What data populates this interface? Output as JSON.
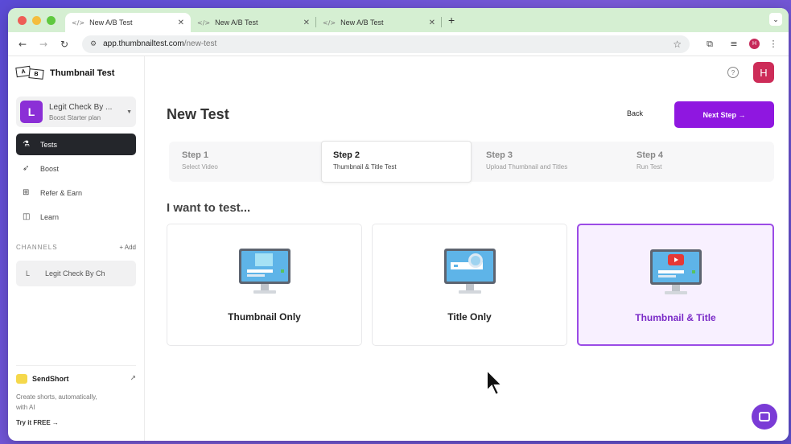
{
  "browser": {
    "tabs": [
      {
        "title": "New A/B Test",
        "active": true
      },
      {
        "title": "New A/B Test",
        "active": false
      },
      {
        "title": "New A/B Test",
        "active": false
      }
    ],
    "url_host": "app.thumbnailtest.com",
    "url_path": "/new-test",
    "profile_initial": "H"
  },
  "brand": {
    "name": "Thumbnail Test",
    "mark_a": "A",
    "mark_b": "B"
  },
  "account": {
    "initial": "L",
    "name": "Legit Check By ...",
    "plan": "Boost Starter plan"
  },
  "nav": [
    {
      "label": "Tests",
      "icon": "flask-icon",
      "active": true
    },
    {
      "label": "Boost",
      "icon": "rocket-icon",
      "active": false
    },
    {
      "label": "Refer & Earn",
      "icon": "gift-icon",
      "active": false
    },
    {
      "label": "Learn",
      "icon": "book-icon",
      "active": false
    }
  ],
  "channels": {
    "heading": "CHANNELS",
    "add_label": "+ Add",
    "items": [
      {
        "initial": "L",
        "name": "Legit Check By Ch"
      }
    ]
  },
  "promo": {
    "title": "SendShort",
    "description": "Create shorts, automatically, with AI",
    "cta": "Try it FREE →"
  },
  "header": {
    "user_initial": "H",
    "help": "?"
  },
  "page": {
    "title": "New Test",
    "back_label": "Back",
    "next_label": "Next Step →",
    "section_title": "I want to test..."
  },
  "steps": [
    {
      "num": "Step 1",
      "desc": "Select Video",
      "active": false
    },
    {
      "num": "Step 2",
      "desc": "Thumbnail & Title Test",
      "active": true
    },
    {
      "num": "Step 3",
      "desc": "Upload Thumbnail and Titles",
      "active": false
    },
    {
      "num": "Step 4",
      "desc": "Run Test",
      "active": false
    }
  ],
  "options": [
    {
      "label": "Thumbnail Only",
      "selected": false
    },
    {
      "label": "Title Only",
      "selected": false
    },
    {
      "label": "Thumbnail & Title",
      "selected": true
    }
  ],
  "colors": {
    "accent": "#8f17e0",
    "selected_border": "#9b4be6",
    "avatar": "#cd2c58",
    "account": "#8b2fd6"
  }
}
